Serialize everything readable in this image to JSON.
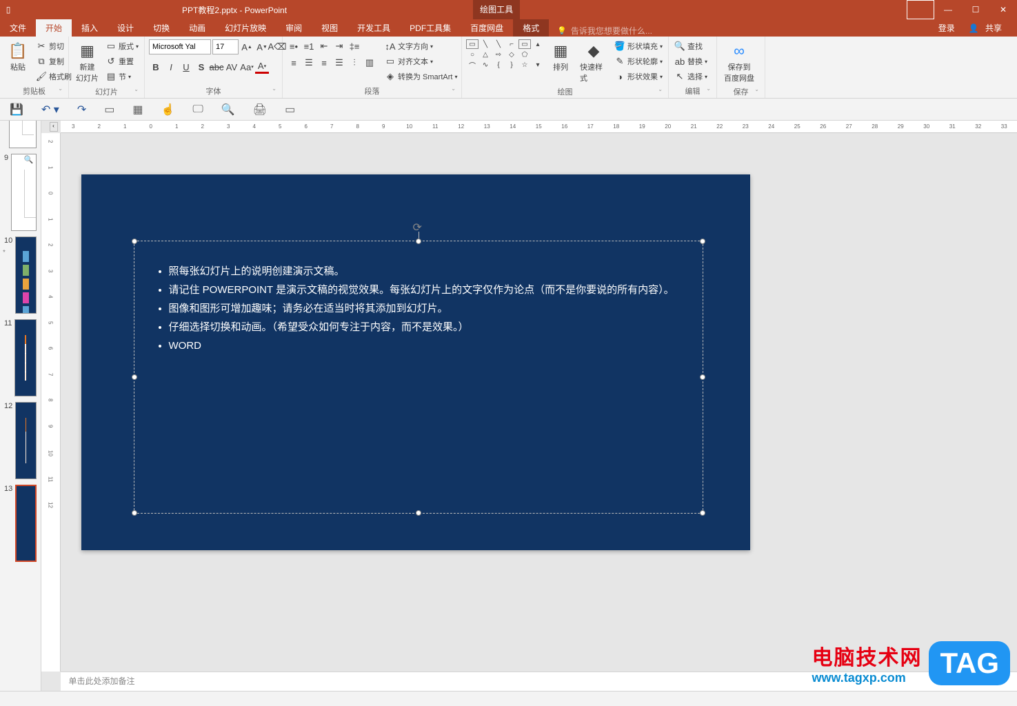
{
  "title": "PPT教程2.pptx - PowerPoint",
  "context_tool_header": "绘图工具",
  "window": {
    "login": "登录",
    "share": "共享"
  },
  "tabs": {
    "file": "文件",
    "home": "开始",
    "insert": "插入",
    "design": "设计",
    "transitions": "切换",
    "animations": "动画",
    "slideshow": "幻灯片放映",
    "review": "审阅",
    "view": "视图",
    "developer": "开发工具",
    "pdf": "PDF工具集",
    "baidu": "百度网盘",
    "format": "格式",
    "tell_me": "告诉我您想要做什么..."
  },
  "ribbon": {
    "clipboard": {
      "paste": "粘贴",
      "cut": "剪切",
      "copy": "复制",
      "format_painter": "格式刷",
      "label": "剪贴板"
    },
    "slides": {
      "new_slide": "新建\n幻灯片",
      "layout": "版式",
      "reset": "重置",
      "section": "节",
      "label": "幻灯片"
    },
    "font": {
      "name": "Microsoft Yal",
      "size": "17",
      "clear": "清除",
      "label": "字体"
    },
    "paragraph": {
      "text_direction": "文字方向",
      "align_text": "对齐文本",
      "smart_art": "转换为 SmartArt",
      "label": "段落"
    },
    "drawing": {
      "arrange": "排列",
      "quick_styles": "快速样式",
      "shape_fill": "形状填充",
      "shape_outline": "形状轮廓",
      "shape_effects": "形状效果",
      "label": "绘图"
    },
    "editing": {
      "find": "查找",
      "replace": "替换",
      "select": "选择",
      "label": "编辑"
    },
    "save": {
      "save_baidu": "保存到\n百度网盘",
      "label": "保存"
    }
  },
  "thumbs": [
    {
      "n": "9"
    },
    {
      "n": "10",
      "anim": "*"
    },
    {
      "n": "11"
    },
    {
      "n": "12"
    },
    {
      "n": "13"
    }
  ],
  "slide_content": {
    "bullets": [
      "照每张幻灯片上的说明创建演示文稿。",
      "请记住 POWERPOINT 是演示文稿的视觉效果。每张幻灯片上的文字仅作为论点（而不是你要说的所有内容）。",
      "图像和图形可增加趣味；请务必在适当时将其添加到幻灯片。",
      "仔细选择切换和动画。（希望受众如何专注于内容，而不是效果。）",
      "WORD"
    ]
  },
  "notes_placeholder": "单击此处添加备注",
  "ruler_h": [
    "3",
    "2",
    "1",
    "0",
    "1",
    "2",
    "3",
    "4",
    "5",
    "6",
    "7",
    "8",
    "9",
    "10",
    "11",
    "12",
    "13",
    "14",
    "15",
    "16",
    "17",
    "18",
    "19",
    "20",
    "21",
    "22",
    "23",
    "24",
    "25",
    "26",
    "27",
    "28",
    "29",
    "30",
    "31",
    "32",
    "33"
  ],
  "ruler_v": [
    "2",
    "1",
    "0",
    "1",
    "2",
    "3",
    "4",
    "5",
    "6",
    "7",
    "8",
    "9",
    "10",
    "11",
    "12"
  ],
  "watermark": {
    "line1": "电脑技术网",
    "line2": "www.tagxp.com",
    "tag": "TAG"
  }
}
